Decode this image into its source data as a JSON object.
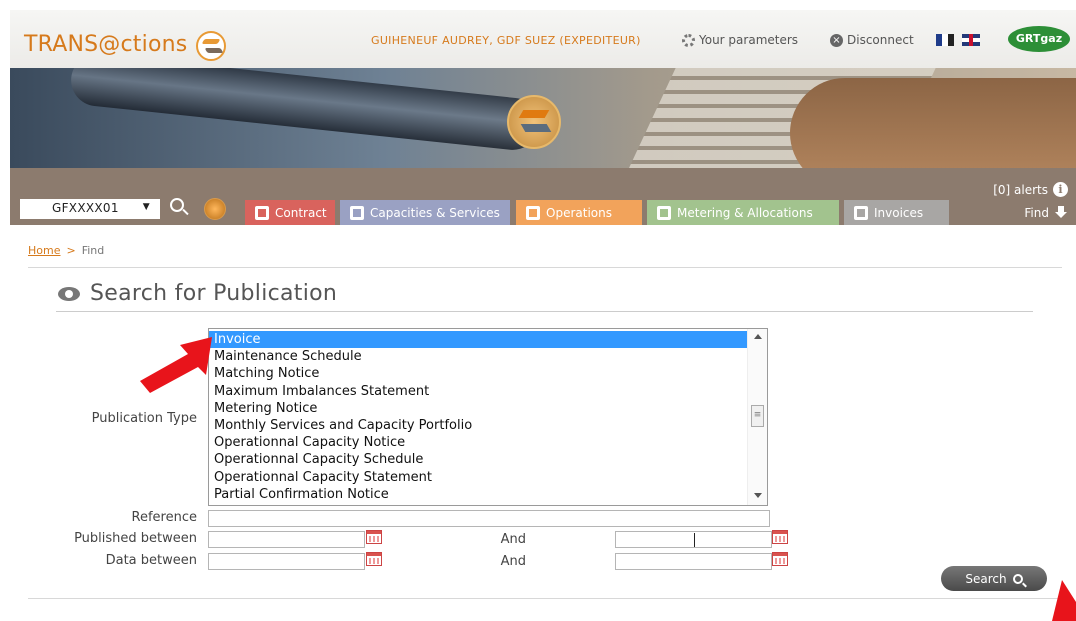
{
  "header": {
    "logo_text": "TRANS@ctions",
    "user": "GUIHENEUF AUDREY, GDF SUEZ (EXPEDITEUR)",
    "parameters_label": "Your parameters",
    "disconnect_label": "Disconnect",
    "partner_logo": "GRTgaz",
    "icons": [
      "gear-icon",
      "close-circle-icon",
      "flag-fr-icon",
      "flag-uk-icon"
    ]
  },
  "nav": {
    "contract_value": "GFXXXX01",
    "tabs": [
      {
        "label": "Contract",
        "color": "#d9635d"
      },
      {
        "label": "Capacities & Services",
        "color": "#9aa1c3"
      },
      {
        "label": "Operations",
        "color": "#f2a35b"
      },
      {
        "label": "Metering & Allocations",
        "color": "#a2c38e"
      },
      {
        "label": "Invoices",
        "color": "#a8a6a4"
      }
    ],
    "alerts_label": "[0] alerts",
    "find_label": "Find",
    "bar_color": "#8c7b6e"
  },
  "breadcrumb": {
    "home": "Home",
    "separator": ">",
    "current": "Find"
  },
  "panel": {
    "title": "Search for Publication",
    "publication_type_label": "Publication Type",
    "publication_types": [
      "Invoice",
      "Maintenance Schedule",
      "Matching Notice",
      "Maximum Imbalances Statement",
      "Metering Notice",
      "Monthly Services and Capacity Portfolio",
      "Operationnal Capacity Notice",
      "Operationnal Capacity Schedule",
      "Operationnal Capacity Statement",
      "Partial Confirmation Notice"
    ],
    "selected_publication_type": "Invoice",
    "reference_label": "Reference",
    "published_between_label": "Published between",
    "data_between_label": "Data between",
    "and_label": "And",
    "search_button": "Search"
  },
  "colors": {
    "accent": "#d67a1c",
    "selection": "#3399ff",
    "annotation_arrow": "#e8141b"
  }
}
